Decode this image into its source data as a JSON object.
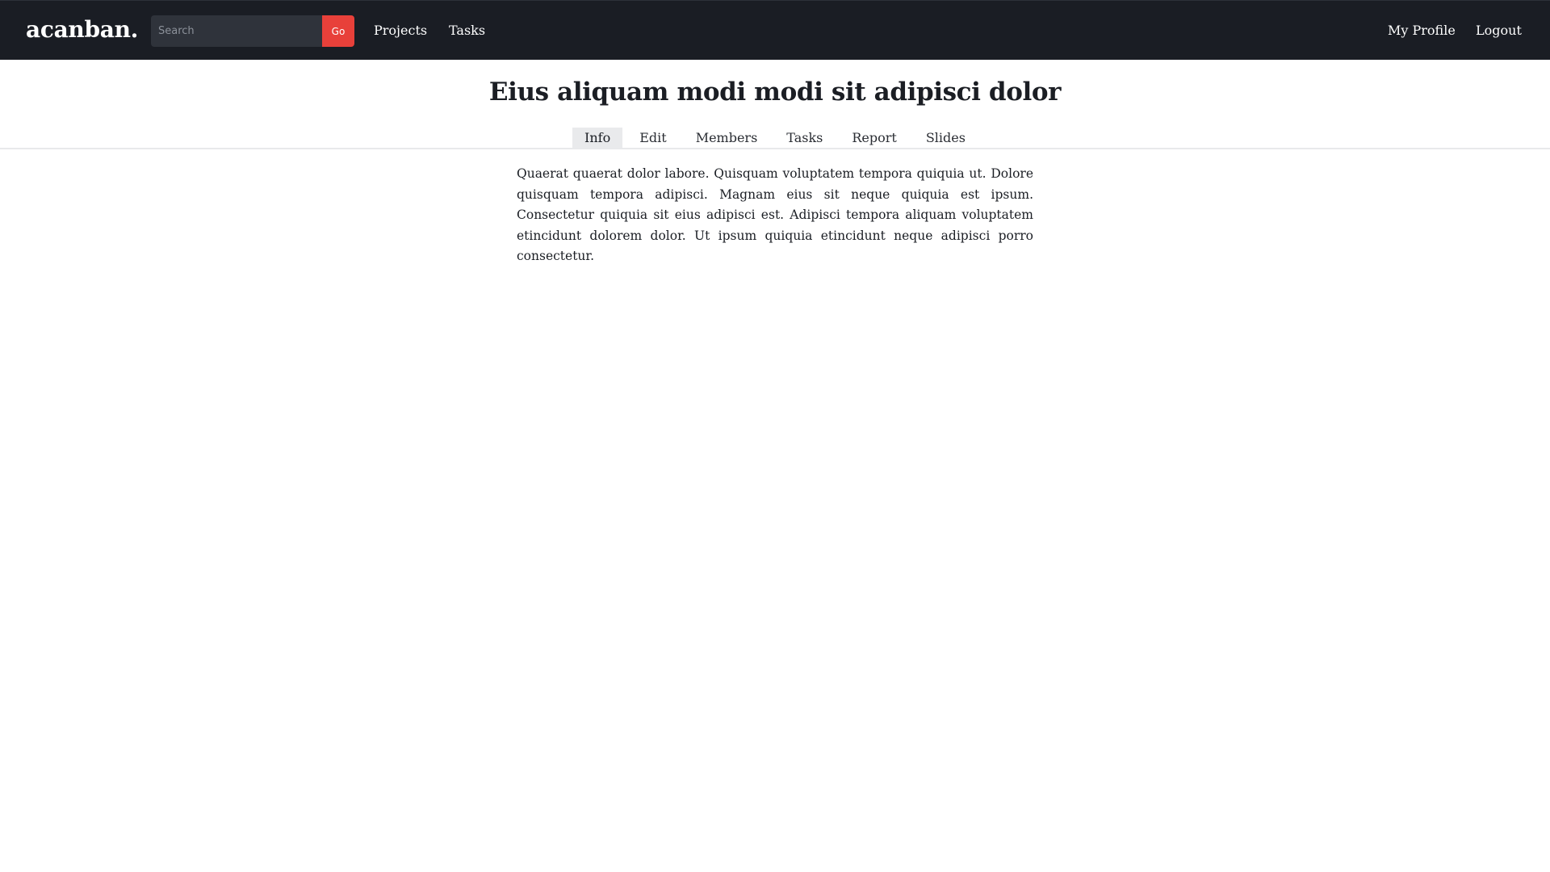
{
  "brand": {
    "name": "acanban."
  },
  "search": {
    "placeholder": "Search",
    "value": "",
    "submit_label": "Go"
  },
  "nav": {
    "left": [
      {
        "label": "Projects"
      },
      {
        "label": "Tasks"
      }
    ],
    "right": [
      {
        "label": "My Profile"
      },
      {
        "label": "Logout"
      }
    ]
  },
  "project": {
    "title": "Eius aliquam modi modi sit adipisci dolor",
    "tabs": [
      {
        "label": "Info",
        "active": true
      },
      {
        "label": "Edit",
        "active": false
      },
      {
        "label": "Members",
        "active": false
      },
      {
        "label": "Tasks",
        "active": false
      },
      {
        "label": "Report",
        "active": false
      },
      {
        "label": "Slides",
        "active": false
      }
    ],
    "description": "Quaerat quaerat dolor labore. Quisquam voluptatem tempora quiquia ut. Dolore quisquam tempora adipisci. Magnam eius sit neque quiquia est ipsum. Consectetur quiquia sit eius adipisci est. Adipisci tempora aliquam voluptatem etincidunt dolorem dolor. Ut ipsum quiquia etincidunt neque adipisci porro consectetur."
  },
  "colors": {
    "topbar_background": "#1a1d24",
    "accent": "#e8403a",
    "active_tab_background": "#e9eaec"
  }
}
